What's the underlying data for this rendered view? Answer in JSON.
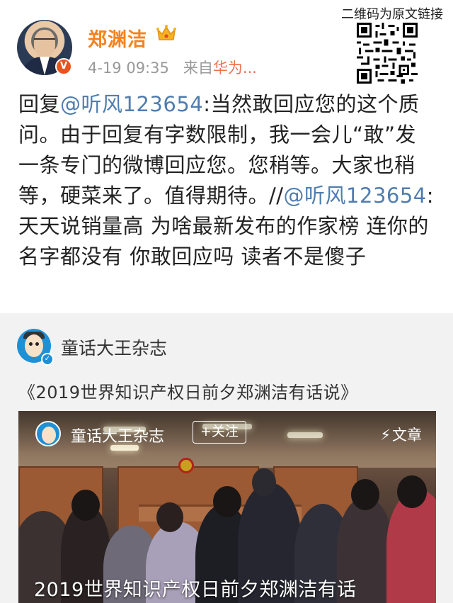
{
  "header": {
    "username": "郑渊洁",
    "timestamp": "4-19 09:35",
    "source_prefix": "来自",
    "source_device": "华为...",
    "qr_caption": "二维码为原文链接"
  },
  "post": {
    "reply_prefix": "回复",
    "mention_1": "@听风123654",
    "text_1": ":当然敢回应您的这个质问。由于回复有字数限制，我一会儿“敢”发一条专门的微博回应您。您稍等。大家也稍等，硬菜来了。值得期待。//",
    "mention_2": "@听风123654",
    "text_2": ":天天说销量高 为啥最新发布的作家榜 连你的名字都没有 你敢回应吗 读者不是傻子"
  },
  "repost": {
    "source_name": "童话大王杂志",
    "article_title": "《2019世界知识产权日前夕郑渊洁有话说》",
    "video": {
      "account_name": "童话大王杂志",
      "follow_label": "+关注",
      "type_label": "文章",
      "caption": "2019世界知识产权日前夕郑渊洁有话"
    }
  },
  "icons": {
    "crown": "crown-icon",
    "verified": "verified-badge-icon",
    "bolt": "lightning-icon",
    "qr": "qr-code-icon"
  },
  "colors": {
    "username": "#f5821f",
    "mention": "#507daf",
    "device": "#eb7350",
    "meta": "#999999"
  }
}
